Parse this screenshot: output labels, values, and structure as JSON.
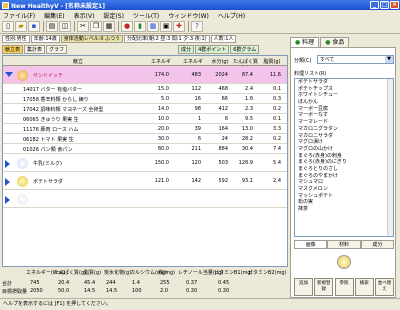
{
  "window": {
    "title": "New HealthyV - [名称未設定1]",
    "buttons": [
      "_",
      "□",
      "×"
    ]
  },
  "menu": [
    "ファイル(F)",
    "編集(E)",
    "表示(V)",
    "設定(S)",
    "ツール(T)",
    "ウィンドウ(W)",
    "ヘルプ(H)"
  ],
  "info": {
    "cells": [
      "性別:男性",
      "年齢:14歳",
      "身体活動レベル:II ふつう",
      "分配比率(朝:2 昼:3 間:1 夕:3 夜:1)",
      "人数:1人"
    ]
  },
  "tabs": [
    "献立表",
    "集計表",
    "グラフ",
    "成分",
    "4群ポイント",
    "6群グラム",
    "バランス"
  ],
  "grid": {
    "headers": [
      "献立",
      "エネルギー(kcal)",
      "エネルギー",
      "水分(g)",
      "たんぱく質(g)",
      "脂質(g)"
    ],
    "rows": [
      {
        "name": "サンドイッチ",
        "v": [
          "174.0",
          "483",
          "2024",
          "87.4",
          "11.6"
        ],
        "kind": "dish"
      },
      {
        "name": "14017 バター 有塩バター",
        "v": [
          "15.0",
          "112",
          "468",
          "2.4",
          "0.1"
        ],
        "kind": "item"
      },
      {
        "name": "17058 香辛料類 からし 練り",
        "v": [
          "5.0",
          "16",
          "66",
          "1.6",
          "0.3"
        ],
        "kind": "item"
      },
      {
        "name": "17042 調味料類 マヨネーズ 全卵型",
        "v": [
          "14.0",
          "98",
          "412",
          "2.3",
          "0.2"
        ],
        "kind": "item"
      },
      {
        "name": "06065 きゅうり 果実 生",
        "v": [
          "10.0",
          "1",
          "6",
          "9.5",
          "0.1"
        ],
        "kind": "item"
      },
      {
        "name": "11176 豚肉 ロース ハム",
        "v": [
          "20.0",
          "39",
          "164",
          "13.0",
          "3.3"
        ],
        "kind": "item"
      },
      {
        "name": "06182 トマト 果実 生",
        "v": [
          "30.0",
          "6",
          "24",
          "28.2",
          "0.2"
        ],
        "kind": "item"
      },
      {
        "name": "01026 パン類 食パン",
        "v": [
          "80.0",
          "211",
          "884",
          "30.4",
          "7.4"
        ],
        "kind": "item"
      },
      {
        "name": "牛乳(ミルク)",
        "v": [
          "150.0",
          "120",
          "503",
          "128.9",
          "5.4"
        ],
        "kind": "dish"
      },
      {
        "name": "ポテトサラダ",
        "v": [
          "121.0",
          "142",
          "592",
          "93.1",
          "2.4"
        ],
        "kind": "dish"
      },
      {
        "name": "",
        "v": [
          "",
          "",
          "",
          "",
          ""
        ],
        "kind": "dish"
      }
    ]
  },
  "footer": {
    "headers": [
      "エネルギー(kcal)",
      "たんぱく質(g)",
      "脂質(g)",
      "炭水化物(g)",
      "カルシウム(mg)",
      "鉄(mg)",
      "レチノール当量(μg)",
      "ビタミンB1(mg)",
      "ビタミンB2(mg)"
    ],
    "labels": [
      "合計",
      "目標摂取量"
    ],
    "totals": [
      "745",
      "20.4",
      "45.4",
      "244",
      "1.4",
      "255",
      "0.37",
      "0.45"
    ],
    "targets": [
      "2050",
      "50.0",
      "14.5",
      "14.5",
      "100",
      "2.0",
      "0.30",
      "0.30"
    ]
  },
  "right_pane": {
    "tabs": [
      "料理",
      "食品"
    ],
    "category_label": "分類(C)",
    "category_value": "すべて",
    "list_label": "料理リスト(R)",
    "list_items": [
      "ポテトサラダ",
      "ポテトチップス",
      "ホワイトシチュー",
      "ほんかん",
      "マーボー豆腐",
      "マーボーなす",
      "マーマレード",
      "マカロニグラタン",
      "マカロニサラダ",
      "マグロ漬け",
      "マグロの山かけ",
      "まぐろ(赤身)の刺身",
      "まぐろ(赤身)のにぎり",
      "まぐろとりのさし",
      "まぐろのやまかけ",
      "マシュマロ",
      "マスクメロン",
      "マッシュポテト",
      "松の実",
      "抹茶"
    ],
    "subtabs": [
      "画像",
      "材料",
      "成分"
    ],
    "buttons": [
      "追加",
      "新規登録",
      "参照",
      "検索",
      "並べ替え"
    ]
  },
  "status": "ヘルプを表示するには [F1] を押してください。"
}
